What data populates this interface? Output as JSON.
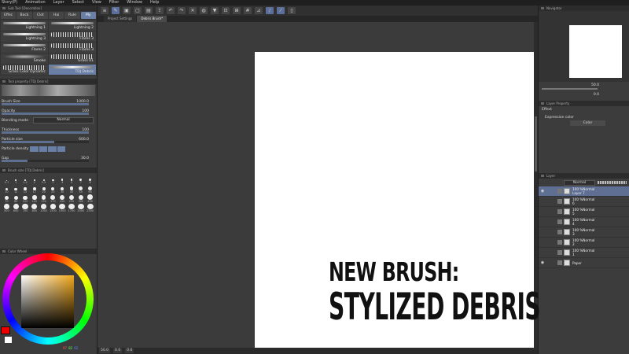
{
  "menubar": {
    "items": [
      "Story(P)",
      "Animation",
      "Layer",
      "Select",
      "View",
      "Filter",
      "Window",
      "Help"
    ]
  },
  "tool_panel": {
    "title": "Sub Tool [Decoration]",
    "subtabs": [
      "Effec",
      "Back",
      "Clot",
      "Hai",
      "Rule",
      "My"
    ]
  },
  "brushes": [
    {
      "name": "Lightning 1",
      "type": "line"
    },
    {
      "name": "Lightning 2",
      "type": "line"
    },
    {
      "name": "Lightning 3",
      "type": "line"
    },
    {
      "name": "Flares 3",
      "type": "grass"
    },
    {
      "name": "Flares 2",
      "type": "line"
    },
    {
      "name": "Flares 3",
      "type": "grass"
    },
    {
      "name": "Smoke",
      "type": "smoke"
    },
    {
      "name": "Grass 01",
      "type": "grass"
    },
    {
      "name": "Grass Color Dynamic",
      "type": "grass"
    },
    {
      "name": "TDJ Debris",
      "type": "line",
      "selected": true
    }
  ],
  "tool_property": {
    "title": "Tool property [TDJ Debris]",
    "brush_size_label": "Brush Size",
    "brush_size_value": "1000.0",
    "brush_size_level": 1.0,
    "opacity_label": "Opacity",
    "opacity_value": "100",
    "opacity_level": 1.0,
    "blending_label": "Blending mode",
    "blending_value": "Normal",
    "thickness_label": "Thickness",
    "thickness_value": "100",
    "thickness_level": 1.0,
    "particle_size_label": "Particle size",
    "particle_size_value": "600.0",
    "particle_size_level": 0.6,
    "particle_density_label": "Particle density",
    "gap_label": "Gap",
    "gap_value": "30.0",
    "gap_level": 0.3
  },
  "brush_size_panel": {
    "title": "Brush size [TDJ Debris]",
    "sizes": [
      "0.7",
      "1",
      "1.5",
      "2",
      "2.5",
      "3",
      "4",
      "5",
      "7",
      "8",
      "10",
      "12",
      "15",
      "17",
      "20",
      "25",
      "30",
      "40",
      "50",
      "60",
      "70",
      "80",
      "100",
      "120",
      "150",
      "170",
      "200",
      "250",
      "300",
      "400",
      "500",
      "600",
      "700",
      "800",
      "1000",
      "1200",
      "1500",
      "1700",
      "2000",
      "2500"
    ]
  },
  "color_wheel": {
    "title": "Color Wheel",
    "r": "97",
    "g": "82",
    "b": "62",
    "accent": "#f2a81a",
    "main_color": "#ee0000"
  },
  "toolbar": {
    "icons": [
      "menu-icon",
      "pen-icon",
      "save-icon",
      "open-icon",
      "image-icon",
      "share-icon",
      "undo-icon",
      "redo-icon",
      "cancel-icon",
      "sphere-icon",
      "fill-icon",
      "crop-icon",
      "transform-icon",
      "grid-icon",
      "ruler-icon",
      "pen-pressure-icon",
      "pen-tilt-icon",
      "device-icon"
    ]
  },
  "tabs": [
    {
      "label": "Project Settings",
      "active": false
    },
    {
      "label": "Debris Brush*",
      "active": true
    }
  ],
  "statusbar": {
    "zoom": "50.0",
    "angle": "0.0",
    "extra": "0.6"
  },
  "navigator": {
    "title": "Navigator",
    "zoom": "50.0",
    "angle": "0.0"
  },
  "layer_property": {
    "title": "Layer Property",
    "effect_label": "Effect",
    "expression_label": "Expression color",
    "color_value": "Color"
  },
  "layers_panel": {
    "title": "Layer",
    "blend_mode": "Normal",
    "layers": [
      {
        "opacity": "100 %Normal",
        "name": "Layer 7",
        "selected": true,
        "visible": true
      },
      {
        "opacity": "100 %Normal",
        "name": "6",
        "selected": false,
        "visible": false
      },
      {
        "opacity": "100 %Normal",
        "name": "5",
        "selected": false,
        "visible": false
      },
      {
        "opacity": "100 %Normal",
        "name": "4",
        "selected": false,
        "visible": false
      },
      {
        "opacity": "100 %Normal",
        "name": "3",
        "selected": false,
        "visible": false
      },
      {
        "opacity": "100 %Normal",
        "name": "2",
        "selected": false,
        "visible": false
      },
      {
        "opacity": "100 %Normal",
        "name": "1",
        "selected": false,
        "visible": false
      },
      {
        "opacity": "",
        "name": "Paper",
        "selected": false,
        "visible": true
      }
    ]
  },
  "overlay": {
    "line1": "NEW BRUSH:",
    "line2": "STYLIZED DEBRIS"
  }
}
